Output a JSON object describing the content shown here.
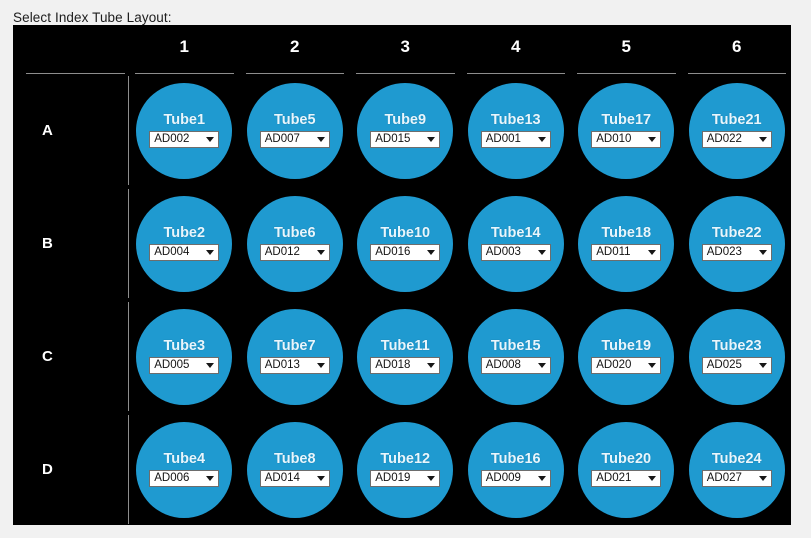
{
  "panel": {
    "label": "Select Index Tube Layout:"
  },
  "grid": {
    "column_headers": [
      "1",
      "2",
      "3",
      "4",
      "5",
      "6"
    ],
    "row_headers": [
      "A",
      "B",
      "C",
      "D"
    ],
    "accent_color": "#1f9ad0",
    "background_color": "#000000",
    "page_background_color": "#f1f1f1",
    "rows": [
      {
        "label": "A",
        "wells": [
          {
            "tube": "Tube1",
            "index": "AD002"
          },
          {
            "tube": "Tube5",
            "index": "AD007"
          },
          {
            "tube": "Tube9",
            "index": "AD015"
          },
          {
            "tube": "Tube13",
            "index": "AD001"
          },
          {
            "tube": "Tube17",
            "index": "AD010"
          },
          {
            "tube": "Tube21",
            "index": "AD022"
          }
        ]
      },
      {
        "label": "B",
        "wells": [
          {
            "tube": "Tube2",
            "index": "AD004"
          },
          {
            "tube": "Tube6",
            "index": "AD012"
          },
          {
            "tube": "Tube10",
            "index": "AD016"
          },
          {
            "tube": "Tube14",
            "index": "AD003"
          },
          {
            "tube": "Tube18",
            "index": "AD011"
          },
          {
            "tube": "Tube22",
            "index": "AD023"
          }
        ]
      },
      {
        "label": "C",
        "wells": [
          {
            "tube": "Tube3",
            "index": "AD005"
          },
          {
            "tube": "Tube7",
            "index": "AD013"
          },
          {
            "tube": "Tube11",
            "index": "AD018"
          },
          {
            "tube": "Tube15",
            "index": "AD008"
          },
          {
            "tube": "Tube19",
            "index": "AD020"
          },
          {
            "tube": "Tube23",
            "index": "AD025"
          }
        ]
      },
      {
        "label": "D",
        "wells": [
          {
            "tube": "Tube4",
            "index": "AD006"
          },
          {
            "tube": "Tube8",
            "index": "AD014"
          },
          {
            "tube": "Tube12",
            "index": "AD019"
          },
          {
            "tube": "Tube16",
            "index": "AD009"
          },
          {
            "tube": "Tube20",
            "index": "AD021"
          },
          {
            "tube": "Tube24",
            "index": "AD027"
          }
        ]
      }
    ]
  }
}
